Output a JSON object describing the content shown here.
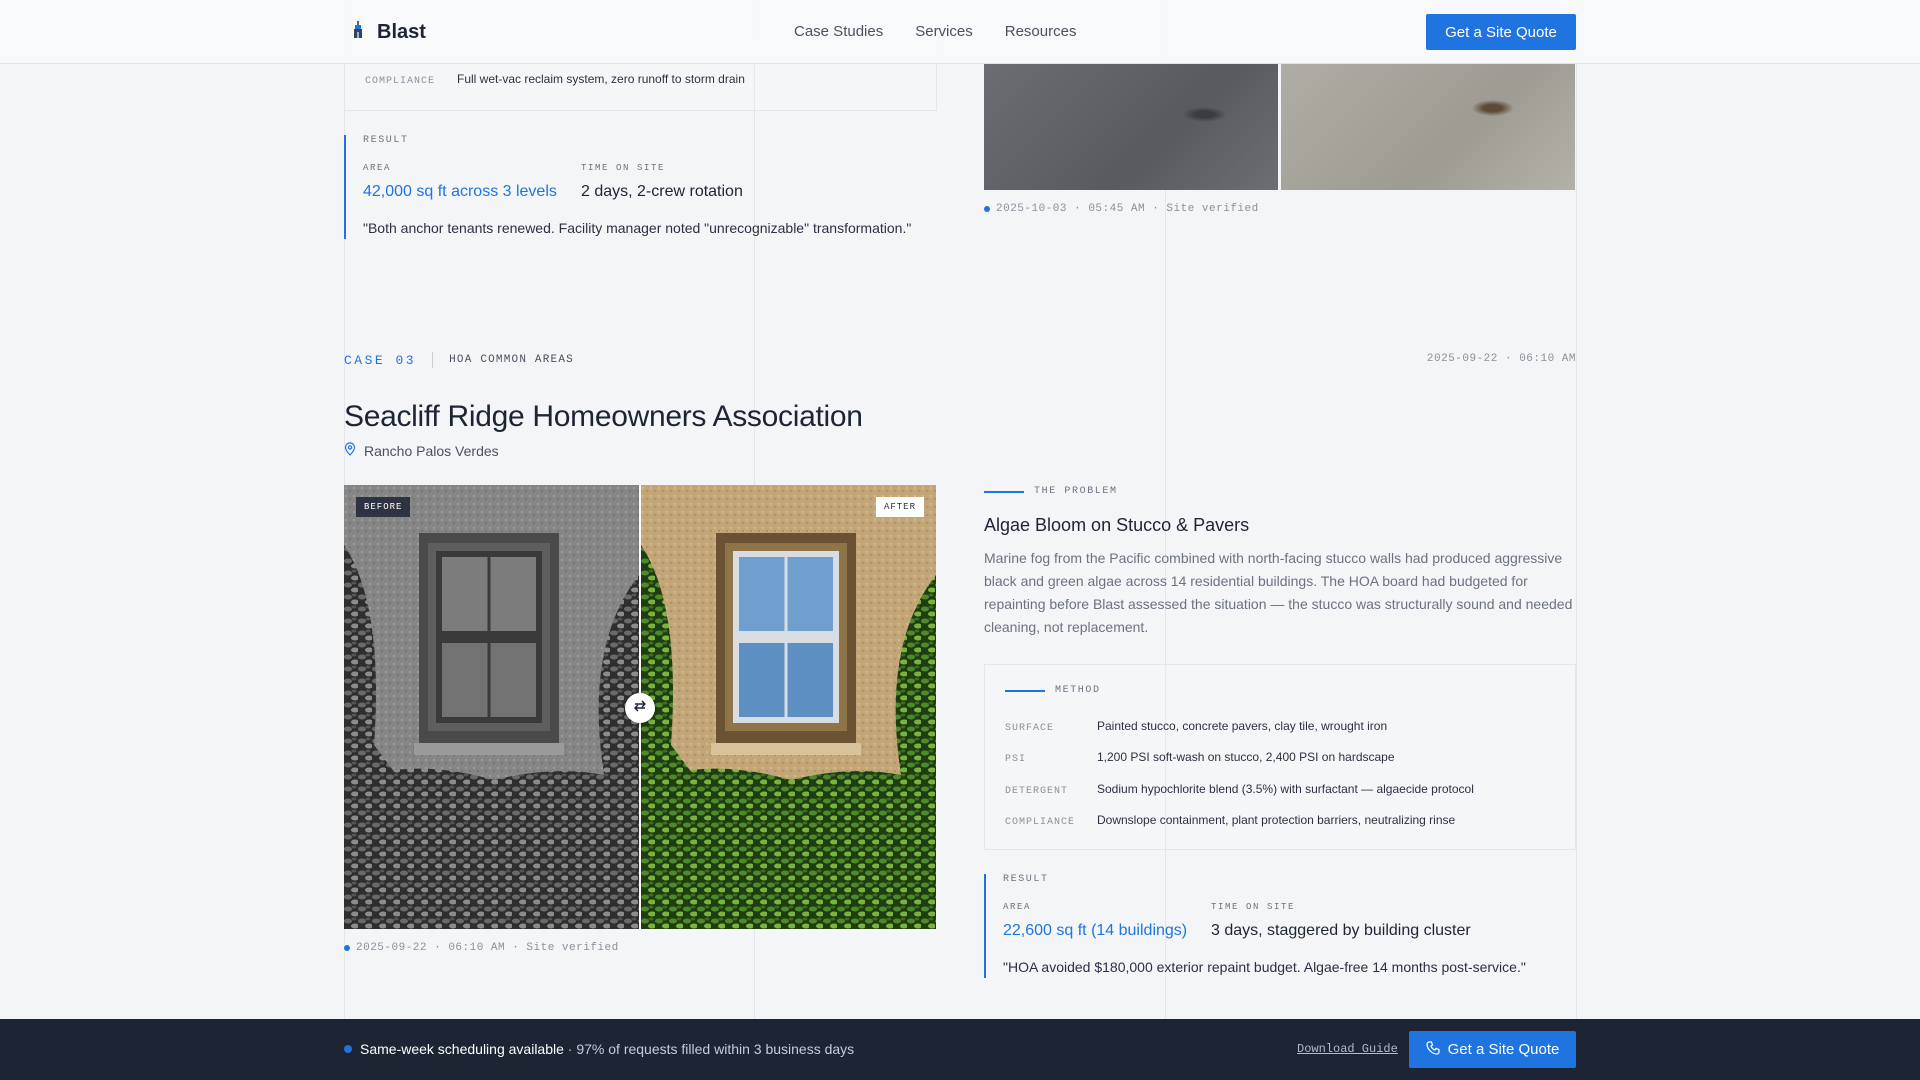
{
  "brand": {
    "name": "Blast",
    "logo_icon": "tower-logo-icon"
  },
  "nav": {
    "items": [
      "Case Studies",
      "Services",
      "Resources"
    ],
    "cta": "Get a Site Quote"
  },
  "case02": {
    "compliance_key": "COMPLIANCE",
    "compliance_val": "Full wet-vac reclaim system, zero runoff to storm drain",
    "timestamp": "2025-10-03 · 05:45 AM · Site verified",
    "result": {
      "label": "RESULT",
      "area_key": "AREA",
      "area_val": "42,000 sq ft across 3 levels",
      "time_key": "TIME ON SITE",
      "time_val": "2 days, 2-crew rotation",
      "quote": "\"Both anchor tenants renewed. Facility manager noted \"unrecognizable\" transformation.\""
    }
  },
  "case03": {
    "number": "CASE 03",
    "category": "HOA COMMON AREAS",
    "date": "2025-09-22 · 06:10 AM",
    "title": "Seacliff Ridge Homeowners Association",
    "location": "Rancho Palos Verdes",
    "before_label": "BEFORE",
    "after_label": "AFTER",
    "photo_timestamp": "2025-09-22 · 06:10 AM · Site verified",
    "problem": {
      "label": "THE PROBLEM",
      "title": "Algae Bloom on Stucco & Pavers",
      "text": "Marine fog from the Pacific combined with north-facing stucco walls had produced aggressive black and green algae across 14 residential buildings. The HOA board had budgeted for repainting before Blast assessed the situation — the stucco was structurally sound and needed cleaning, not replacement."
    },
    "method": {
      "label": "METHOD",
      "rows": [
        {
          "key": "SURFACE",
          "val": "Painted stucco, concrete pavers, clay tile, wrought iron"
        },
        {
          "key": "PSI",
          "val": "1,200 PSI soft-wash on stucco, 2,400 PSI on hardscape"
        },
        {
          "key": "DETERGENT",
          "val": "Sodium hypochlorite blend (3.5%) with surfactant — algaecide protocol"
        },
        {
          "key": "COMPLIANCE",
          "val": "Downslope containment, plant protection barriers, neutralizing rinse"
        }
      ]
    },
    "result": {
      "label": "RESULT",
      "area_key": "AREA",
      "area_val": "22,600 sq ft (14 buildings)",
      "time_key": "TIME ON SITE",
      "time_val": "3 days, staggered by building cluster",
      "quote": "\"HOA avoided $180,000 exterior repaint budget. Algae-free 14 months post-service.\""
    }
  },
  "footer_bar": {
    "highlight": "Same-week scheduling available",
    "rest": " · 97% of requests filled within 3 business days",
    "link": "Download Guide",
    "cta": "Get a Site Quote"
  },
  "colors": {
    "accent": "#1f74e0",
    "dark": "#1d2433",
    "background": "#f4f5f7"
  }
}
